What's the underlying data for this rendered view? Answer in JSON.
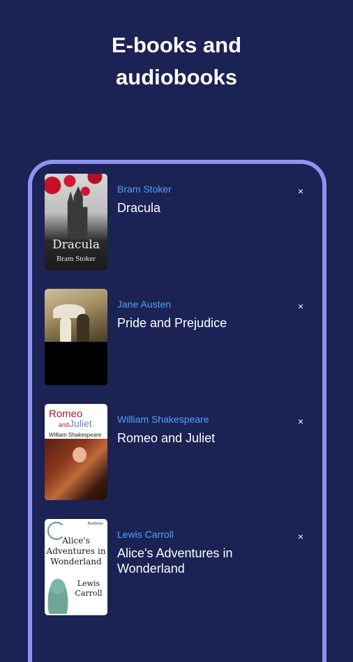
{
  "headline": {
    "line1": "E-books and",
    "line2": "audiobooks"
  },
  "books": [
    {
      "author": "Bram Stoker",
      "title": "Dracula",
      "cover": {
        "title": "Dracula",
        "author": "Bram Stoker"
      },
      "close_label": "×"
    },
    {
      "author": "Jane Austen",
      "title": "Pride and Prejudice",
      "close_label": "×"
    },
    {
      "author": "William Shakespeare",
      "title": "Romeo and Juliet",
      "cover": {
        "title_1": "Romeo",
        "and": "and",
        "title_2": "Juliet",
        "author": "William Shakespeare"
      },
      "close_label": "×"
    },
    {
      "author": "Lewis Carroll",
      "title": "Alice's Adventures in Wonderland",
      "cover": {
        "publisher": "Bookboon",
        "title": "Alice's Adventures in Wonderland",
        "author": "Lewis Carroll"
      },
      "close_label": "×"
    }
  ],
  "colors": {
    "background": "#1b2254",
    "frame": "#8f93f0",
    "author": "#4da3ff"
  }
}
